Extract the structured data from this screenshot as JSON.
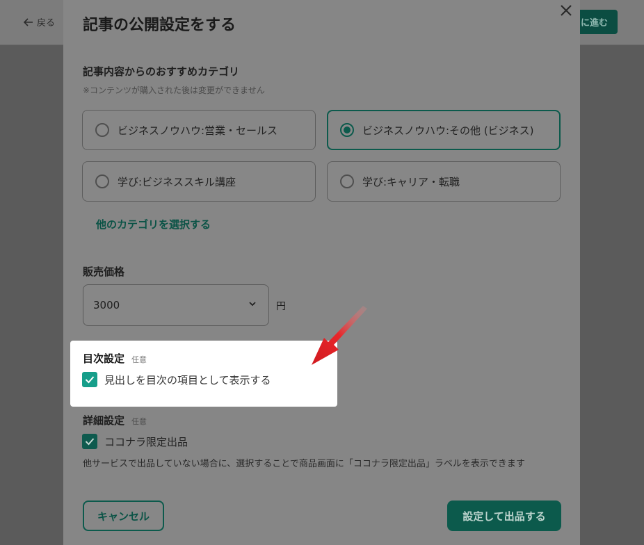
{
  "background": {
    "back_label": "戻る",
    "next_label": "に進む"
  },
  "modal": {
    "title": "記事の公開設定をする",
    "category": {
      "heading": "記事内容からのおすすめカテゴリ",
      "note": "※コンテンツが購入された後は変更ができません",
      "options": [
        {
          "label": "ビジネスノウハウ:営業・セールス",
          "selected": false
        },
        {
          "label": "ビジネスノウハウ:その他 (ビジネス)",
          "selected": true
        },
        {
          "label": "学び:ビジネススキル講座",
          "selected": false
        },
        {
          "label": "学び:キャリア・転職",
          "selected": false
        }
      ],
      "other_link": "他のカテゴリを選択する"
    },
    "price": {
      "heading": "販売価格",
      "value": "3000",
      "unit": "円"
    },
    "toc": {
      "heading": "目次設定",
      "optional_tag": "任意",
      "checkbox_label": "見出しを目次の項目として表示する",
      "checked": true
    },
    "detail": {
      "heading": "詳細設定",
      "optional_tag": "任意",
      "checkbox_label": "ココナラ限定出品",
      "checked": true,
      "description": "他サービスで出品していない場合に、選択することで商品画面に「ココナラ限定出品」ラベルを表示できます"
    },
    "buttons": {
      "cancel": "キャンセル",
      "submit": "設定して出品する"
    }
  },
  "colors": {
    "accent": "#0c5a4c",
    "check_active": "#169e8a",
    "arrow": "#e8262a"
  }
}
